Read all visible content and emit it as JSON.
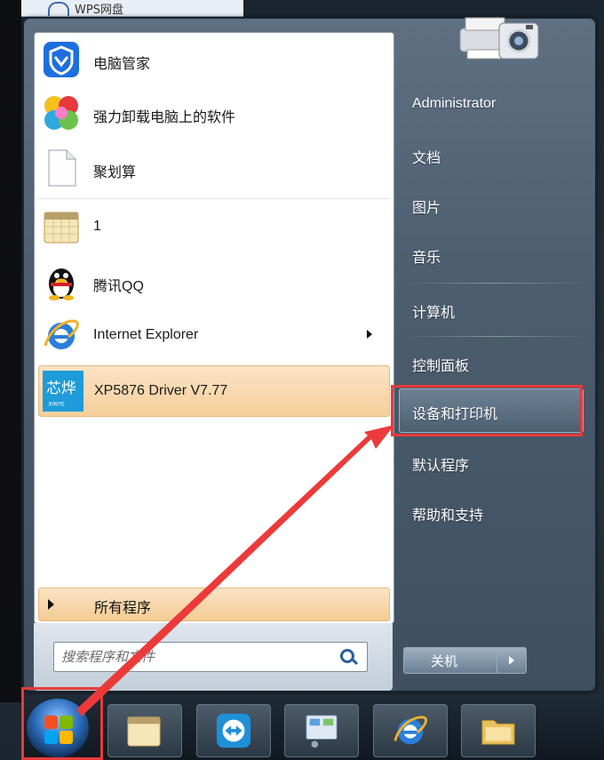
{
  "top_strip": {
    "label": "WPS网盘"
  },
  "left_menu": {
    "items": [
      {
        "label": "电脑管家",
        "icon": "tencent-manager-icon"
      },
      {
        "label": "强力卸载电脑上的软件",
        "icon": "uninstall-icon"
      },
      {
        "label": "聚划算",
        "icon": "document-icon"
      },
      {
        "label": "1",
        "icon": "calendar-icon"
      },
      {
        "label": "腾讯QQ",
        "icon": "qq-penguin-icon"
      },
      {
        "label": "Internet Explorer",
        "icon": "ie-icon"
      },
      {
        "label": "XP5876 Driver V7.77",
        "icon": "xinye-icon"
      }
    ],
    "all_programs_label": "所有程序"
  },
  "search": {
    "placeholder": "搜索程序和文件"
  },
  "right_menu": {
    "user": "Administrator",
    "items": [
      "文档",
      "图片",
      "音乐",
      "计算机",
      "控制面板",
      "设备和打印机",
      "默认程序",
      "帮助和支持"
    ],
    "shutdown_label": "关机"
  },
  "colors": {
    "highlight": "#e53b3b",
    "menu_selected": "#f6cf9c"
  }
}
